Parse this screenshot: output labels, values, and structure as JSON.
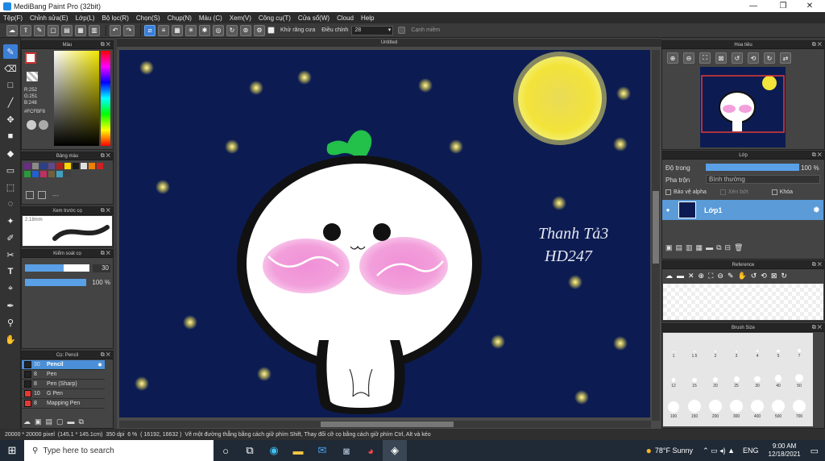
{
  "window": {
    "title": "MediBang Paint Pro (32bit)",
    "minimize": "—",
    "maximize": "❐",
    "close": "✕"
  },
  "menu": [
    "Tệp(F)",
    "Chỉnh sửa(E)",
    "Lớp(L)",
    "Bộ lọc(R)",
    "Chọn(S)",
    "Chụp(N)",
    "Màu (C)",
    "Xem(V)",
    "Công cụ(T)",
    "Cửa sổ(W)",
    "Cloud",
    "Help"
  ],
  "toolbar": {
    "antialias_label": "Khử răng cưa",
    "adjust_label": "Điều chỉnh",
    "adjust_value": "28",
    "edge_label": "Cạnh miềm"
  },
  "color_panel": {
    "title": "Màu",
    "r": "R:252",
    "g": "G:251",
    "b": "B:248",
    "hex": "#FCFBF8"
  },
  "palette": {
    "title": "Bảng màu",
    "extra": "---"
  },
  "brush_preview": {
    "title": "Xem trước cọ",
    "size": "2.18mm"
  },
  "brush_control": {
    "title": "Kiểm soát cọ",
    "size": "30",
    "opacity": "100 %",
    "size_level": 0.6,
    "opacity_level": 1.0
  },
  "brush_list": {
    "title": "Cọ: Pencil",
    "items": [
      {
        "size": "30",
        "name": "Pencil",
        "color": "#222222",
        "selected": true
      },
      {
        "size": "8",
        "name": "Pen",
        "color": "#222222",
        "selected": false
      },
      {
        "size": "8",
        "name": "Pen (Sharp)",
        "color": "#222222",
        "selected": false
      },
      {
        "size": "10",
        "name": "G Pen",
        "color": "#e53935",
        "selected": false
      },
      {
        "size": "8",
        "name": "Mapping Pen",
        "color": "#e53935",
        "selected": false
      }
    ]
  },
  "canvas": {
    "title": "Untitled",
    "signature_line1": "Thanh Tả3",
    "signature_line2": "HD247"
  },
  "navigator": {
    "title": "Hoa tiêu"
  },
  "layer_panel": {
    "title": "Lớp",
    "opacity_label": "Độ trong",
    "opacity_value": "100 %",
    "opacity_level": 1.0,
    "blend_label": "Pha trộn",
    "blend_value": "Bình thường",
    "protect_alpha": "Bảo vệ alpha",
    "clip": "Xén bớt",
    "lock": "Khóa",
    "layer_name": "Lớp1"
  },
  "reference": {
    "title": "Reference"
  },
  "brush_size": {
    "title": "Brush Size",
    "sizes": [
      "1",
      "1.5",
      "2",
      "3",
      "4",
      "5",
      "7",
      "12",
      "15",
      "20",
      "25",
      "30",
      "40",
      "50",
      "100",
      "150",
      "200",
      "300",
      "400",
      "500",
      "700"
    ]
  },
  "status": {
    "dims": "20000 * 20000 pixel",
    "cm": "(145.1 * 145.1cm)",
    "dpi": "350 dpi",
    "zoom": "6 %",
    "coords": "( 16192, 16632 )",
    "hint": "Vẽ một đường thẳng bằng cách giữ phím Shift, Thay đổi cỡ cọ bằng cách giữ phím Ctrl, Alt và kéo"
  },
  "taskbar": {
    "search_placeholder": "Type here to search",
    "weather": "78°F  Sunny",
    "lang": "ENG",
    "time": "9:00 AM",
    "date": "12/18/2021"
  }
}
